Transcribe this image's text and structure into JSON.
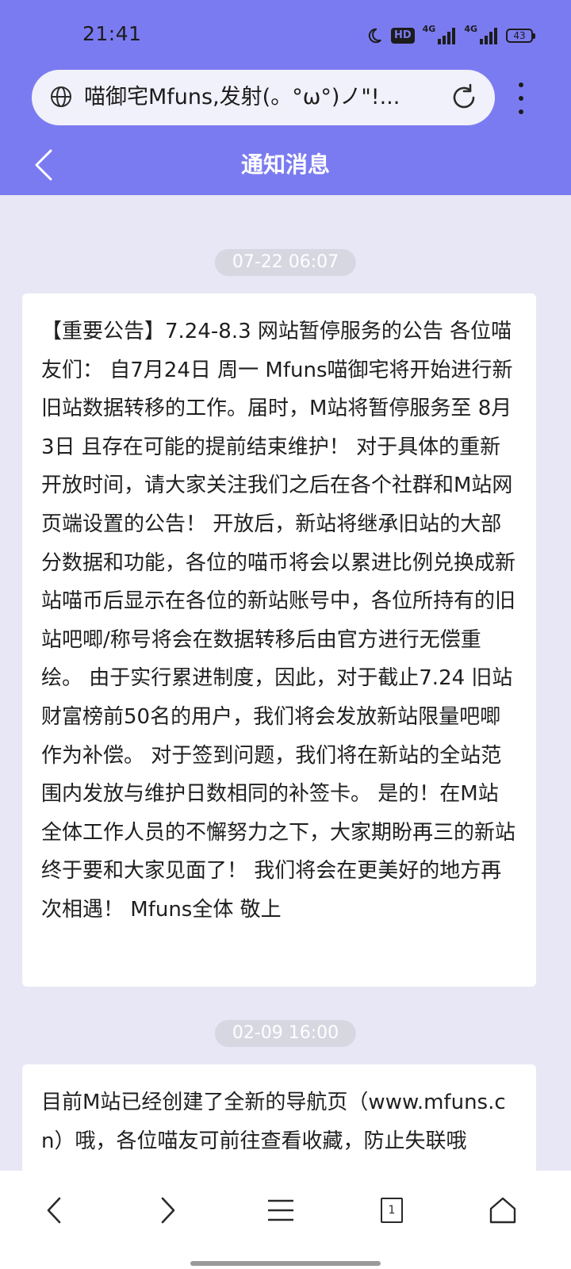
{
  "status": {
    "time": "21:41",
    "hd_badge": "HD",
    "network_1": "4G",
    "network_2": "4G",
    "battery": "43"
  },
  "browser": {
    "address_text": "喵御宅Mfuns,发射(。°ω°)ノ\"!...",
    "icons": {
      "site": "globe-icon",
      "reload": "reload-icon",
      "menu": "more-vertical-icon"
    }
  },
  "header": {
    "title": "通知消息",
    "back_icon": "chevron-left-icon"
  },
  "notices": [
    {
      "time": "07-22 06:07",
      "text": "【重要公告】7.24-8.3 网站暂停服务的公告 各位喵友们： 自7月24日 周一 Mfuns喵御宅将开始进行新旧站数据转移的工作。届时，M站将暂停服务至 8月3日 且存在可能的提前结束维护！ 对于具体的重新开放时间，请大家关注我们之后在各个社群和M站网页端设置的公告！ 开放后，新站将继承旧站的大部分数据和功能，各位的喵币将会以累进比例兑换成新站喵币后显示在各位的新站账号中，各位所持有的旧站吧唧/称号将会在数据转移后由官方进行无偿重绘。 由于实行累进制度，因此，对于截止7.24 旧站财富榜前50名的用户，我们将会发放新站限量吧唧作为补偿。 对于签到问题，我们将在新站的全站范围内发放与维护日数相同的补签卡。 是的！在M站全体工作人员的不懈努力之下，大家期盼再三的新站终于要和大家见面了！ 我们将会在更美好的地方再次相遇！ Mfuns全体 敬上"
    },
    {
      "time": "02-09 16:00",
      "text": "目前M站已经创建了全新的导航页（www.mfuns.cn）哦，各位喵友可前往查看收藏，防止失联哦"
    }
  ],
  "bottom_nav": {
    "tab_count": "1",
    "icons": [
      "back-icon",
      "forward-icon",
      "menu-icon",
      "tabs-icon",
      "home-icon"
    ]
  },
  "colors": {
    "accent": "#7b7bf1",
    "page_background": "#e7e7f6",
    "card_background": "#ffffff",
    "time_chip": "#d7d7e2"
  }
}
